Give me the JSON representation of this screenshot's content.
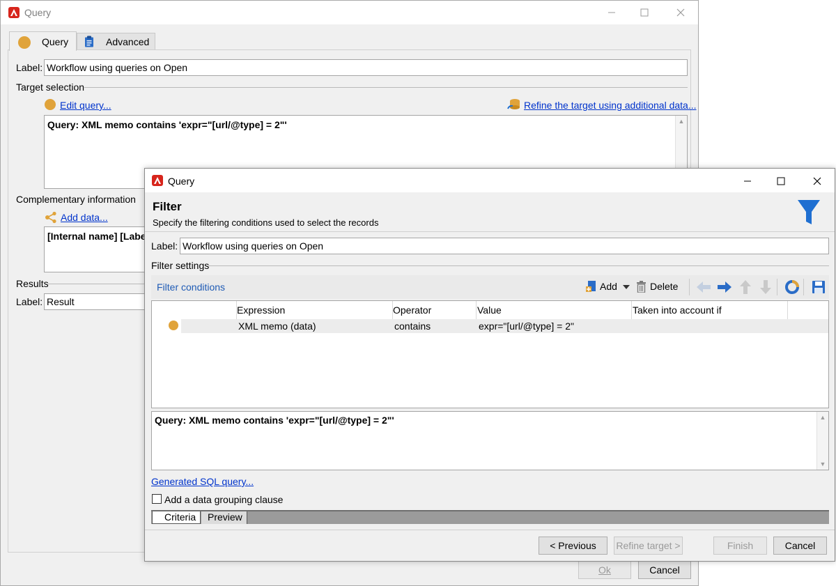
{
  "back_window": {
    "title": "Query",
    "tabs": [
      {
        "label": "Query"
      },
      {
        "label": "Advanced"
      }
    ],
    "label_caption": "Label:",
    "label_value": "Workflow using queries on Open",
    "target_selection": "Target selection",
    "edit_query": "Edit query...",
    "refine_link": "Refine the target using additional data...",
    "query_text": "Query: XML memo contains 'expr=\"[url/@type] = 2\"'",
    "complementary": "Complementary information",
    "add_data": "Add data...",
    "comp_columns": "[Internal name]  [Label",
    "results": "Results",
    "result_caption": "Label:",
    "result_value": "Result",
    "ok": "Ok",
    "cancel": "Cancel"
  },
  "front_window": {
    "title": "Query",
    "heading": "Filter",
    "description": "Specify the filtering conditions used to select the records",
    "label_caption": "Label:",
    "label_value": "Workflow using queries on Open",
    "filter_settings": "Filter settings",
    "filter_conditions": "Filter conditions",
    "toolbar": {
      "add": "Add",
      "delete": "Delete"
    },
    "grid": {
      "headers": [
        "Expression",
        "Operator",
        "Value",
        "Taken into account if"
      ],
      "rows": [
        {
          "expression": "XML memo (data)",
          "operator": "contains",
          "value": "expr=\"[url/@type] = 2\"",
          "taken": ""
        }
      ]
    },
    "query_text": "Query: XML memo contains 'expr=\"[url/@type] = 2\"'",
    "generated_sql": "Generated SQL query...",
    "grouping_clause": "Add a data grouping clause",
    "bottom_tabs": [
      {
        "label": "Criteria"
      },
      {
        "label": "Preview"
      }
    ],
    "buttons": {
      "previous": "< Previous",
      "refine": "Refine target >",
      "finish": "Finish",
      "cancel": "Cancel"
    }
  },
  "colors": {
    "accent_orange": "#e0a33a",
    "link_blue": "#0033cc",
    "filter_icon": "#1f6fd1",
    "logo_red": "#d7251c"
  }
}
